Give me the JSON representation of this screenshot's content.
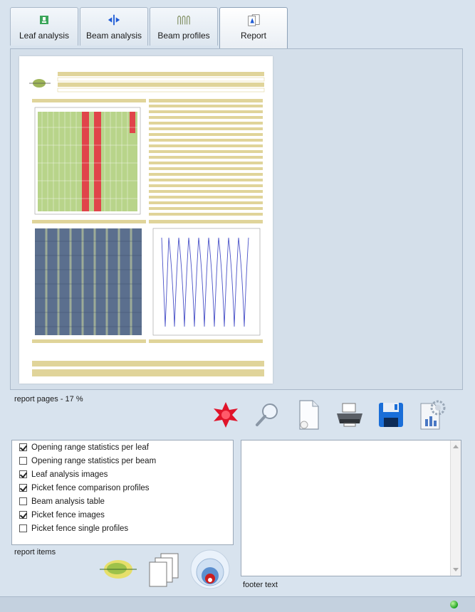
{
  "tabs": [
    {
      "label": "Leaf analysis",
      "icon": "leaf-analysis-icon"
    },
    {
      "label": "Beam analysis",
      "icon": "beam-analysis-icon"
    },
    {
      "label": "Beam profiles",
      "icon": "beam-profiles-icon"
    },
    {
      "label": "Report",
      "icon": "report-icon",
      "active": true
    }
  ],
  "preview": {
    "caption": "report pages - 17 %"
  },
  "actions": [
    {
      "name": "generate-report-icon"
    },
    {
      "name": "zoom-icon"
    },
    {
      "name": "export-pdf-icon"
    },
    {
      "name": "print-icon"
    },
    {
      "name": "save-icon"
    },
    {
      "name": "settings-icon"
    }
  ],
  "report_items": {
    "caption": "report items",
    "items": [
      {
        "label": "Opening range statistics per leaf",
        "checked": true
      },
      {
        "label": "Opening range statistics per beam",
        "checked": false
      },
      {
        "label": "Leaf analysis images",
        "checked": true
      },
      {
        "label": "Picket fence comparison profiles",
        "checked": true
      },
      {
        "label": "Beam analysis table",
        "checked": false
      },
      {
        "label": "Picket fence images",
        "checked": true
      },
      {
        "label": "Picket fence single profiles",
        "checked": false
      }
    ]
  },
  "footer": {
    "caption": "footer text",
    "value": ""
  },
  "colors": {
    "accent_band": "#e0d49a",
    "status_ok": "#1fa31f"
  }
}
